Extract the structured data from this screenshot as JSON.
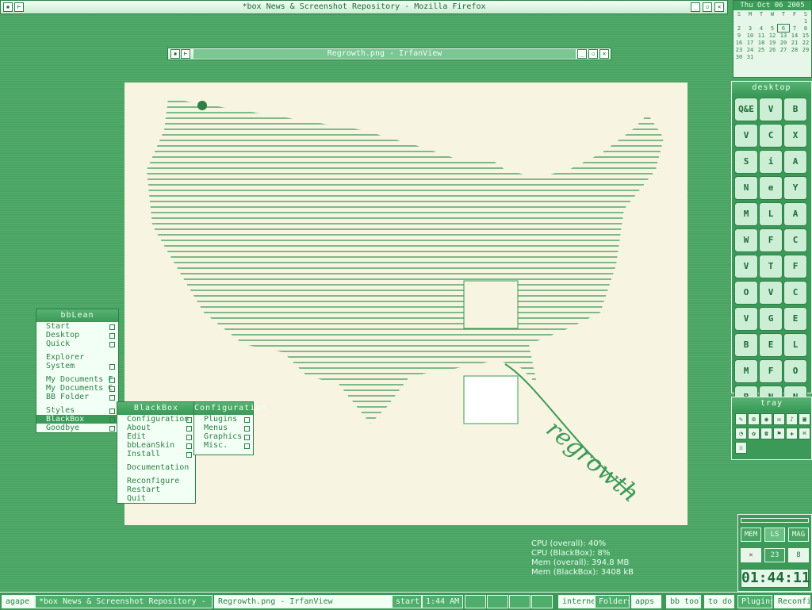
{
  "firefox": {
    "title": "*box News & Screenshot Repository - Mozilla Firefox"
  },
  "calendar": {
    "header": "Thu Oct 06 2005",
    "weekdays": [
      "S",
      "M",
      "T",
      "W",
      "T",
      "F",
      "S"
    ],
    "rows": [
      [
        "",
        "",
        "",
        "",
        "",
        "",
        "1"
      ],
      [
        "2",
        "3",
        "4",
        "5",
        "6",
        "7",
        "8"
      ],
      [
        "9",
        "10",
        "11",
        "12",
        "13",
        "14",
        "15"
      ],
      [
        "16",
        "17",
        "18",
        "19",
        "20",
        "21",
        "22"
      ],
      [
        "23",
        "24",
        "25",
        "26",
        "27",
        "28",
        "29"
      ],
      [
        "30",
        "31",
        "",
        "",
        "",
        "",
        ""
      ]
    ]
  },
  "irfanview": {
    "title": "Regrowth.png - IrfanView",
    "image_text": "regrowth"
  },
  "desktop_panel": {
    "title": "desktop",
    "icons": [
      "Q&E",
      "V",
      "B",
      "V",
      "C",
      "X",
      "S",
      "i",
      "A",
      "N",
      "e",
      "Y",
      "M",
      "L",
      "A",
      "W",
      "F",
      "C",
      "V",
      "T",
      "F",
      "O",
      "V",
      "C",
      "V",
      "G",
      "E",
      "B",
      "E",
      "L",
      "M",
      "F",
      "O",
      "B",
      "N",
      "N"
    ]
  },
  "tray_panel": {
    "title": "tray",
    "icons": [
      "✎",
      "⚙",
      "◉",
      "✉",
      "♪",
      "▣",
      "◔",
      "✿",
      "☎",
      "⚑",
      "✚",
      "⌘",
      "☏"
    ]
  },
  "sysmon": {
    "mem": "MEM",
    "ls": "LS",
    "mag": "MAG",
    "val": "23",
    "clock": "01:44:11"
  },
  "stats": {
    "cpu_overall": "CPU (overall): 40%",
    "cpu_bb": "CPU (BlackBox): 8%",
    "mem_overall": "Mem (overall): 394.8 MB",
    "mem_bb": "Mem (BlackBox): 3408 kB"
  },
  "bblean_menu": {
    "title": "bbLean",
    "items": [
      "Start",
      "Desktop",
      "Quick",
      "Explorer",
      "System",
      "My Documents F",
      "My Documents C",
      "BB Folder",
      "Styles",
      "BlackBox",
      "Goodbye"
    ]
  },
  "blackbox_menu": {
    "title": "BlackBox",
    "items": [
      "Configuration",
      "About",
      "Edit",
      "bbLeanSkin",
      "Install",
      "Documentation",
      "Reconfigure",
      "Restart",
      "Quit"
    ]
  },
  "config_menu": {
    "title": "Configuration",
    "items": [
      "Plugins",
      "Menus",
      "Graphics",
      "Misc."
    ]
  },
  "taskbar": {
    "agape": "agape",
    "task1": "*box News & Screenshot Repository - ...",
    "task2": "Regrowth.png - IrfanView",
    "start": "start",
    "time": "1:44 AM",
    "launch": [
      "internet",
      "Folders",
      "apps",
      "bb tools",
      "to do",
      "Plugins",
      "Reconfig"
    ]
  }
}
